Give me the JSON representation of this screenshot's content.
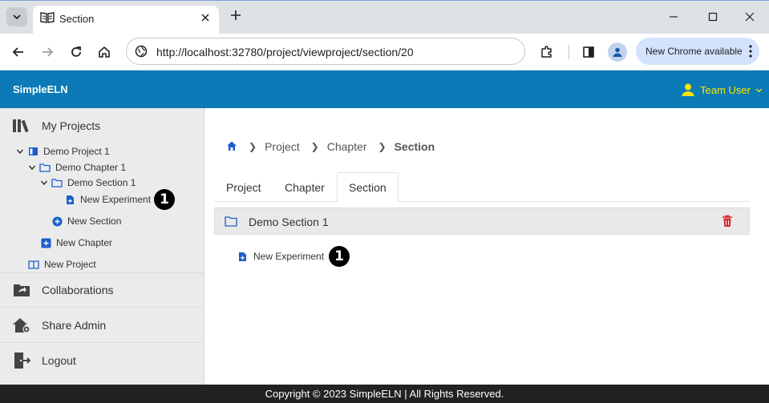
{
  "browser": {
    "tab_title": "Section",
    "url": "http://localhost:32780/project/viewproject/section/20",
    "update_label": "New Chrome available"
  },
  "app": {
    "brand": "SimpleELN",
    "user_label": "Team User",
    "accent_color": "#0b7ab6",
    "user_color": "#ffe600"
  },
  "sidebar": {
    "my_projects": "My Projects",
    "tree": {
      "project": "Demo Project 1",
      "chapter": "Demo Chapter 1",
      "section": "Demo Section 1",
      "experiment": "New Experiment",
      "new_section": "New Section",
      "new_chapter": "New Chapter",
      "new_project": "New Project"
    },
    "collaborations": "Collaborations",
    "share_admin": "Share Admin",
    "logout": "Logout"
  },
  "main": {
    "breadcrumb": [
      "Project",
      "Chapter",
      "Section"
    ],
    "tabs": [
      "Project",
      "Chapter",
      "Section"
    ],
    "active_tab": "Section",
    "section_title": "Demo Section 1",
    "experiment_link": "New Experiment"
  },
  "annotations": {
    "marker_label": "1"
  },
  "footer": {
    "text": "Copyright © 2023 SimpleELN | All Rights Reserved."
  }
}
